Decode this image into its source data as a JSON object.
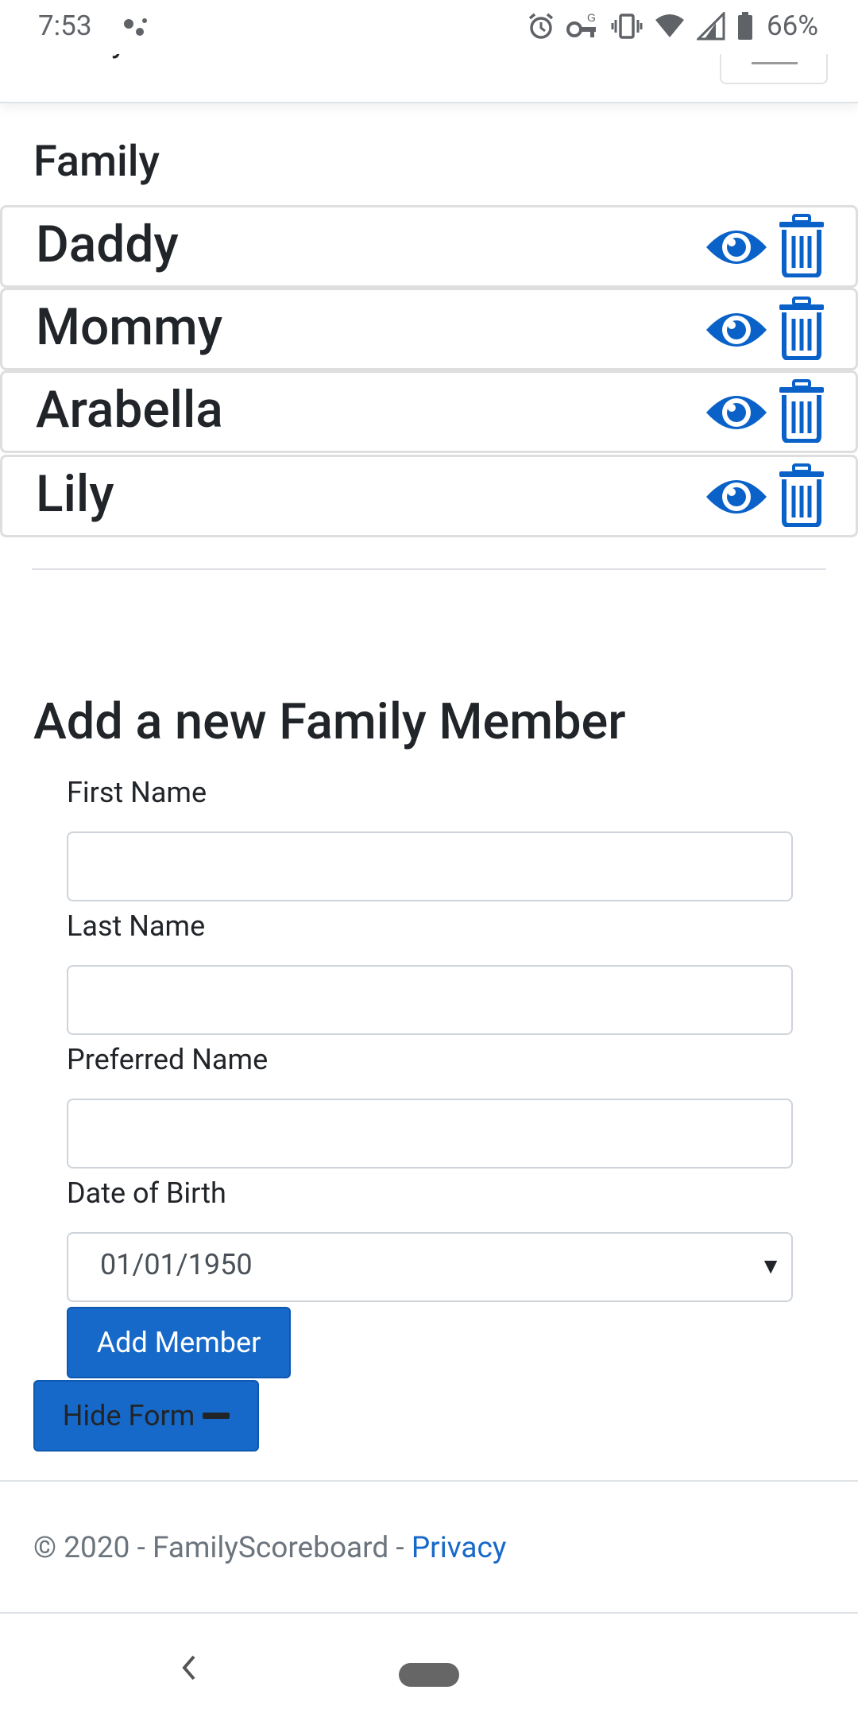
{
  "status": {
    "time": "7:53",
    "battery": "66%"
  },
  "navbar": {
    "brand": "FamilyScoreboard"
  },
  "family": {
    "heading": "Family",
    "members": [
      {
        "name": "Daddy"
      },
      {
        "name": "Mommy"
      },
      {
        "name": "Arabella"
      },
      {
        "name": "Lily"
      }
    ]
  },
  "form": {
    "heading": "Add a new Family Member",
    "first_name_label": "First Name",
    "first_name_value": "",
    "last_name_label": "Last Name",
    "last_name_value": "",
    "preferred_name_label": "Preferred Name",
    "preferred_name_value": "",
    "dob_label": "Date of Birth",
    "dob_value": "01/01/1950",
    "submit_label": "Add Member",
    "hide_label": "Hide Form"
  },
  "footer": {
    "text": "© 2020 - FamilyScoreboard - ",
    "privacy_link": "Privacy"
  },
  "colors": {
    "primary": "#1769c9",
    "icon": "#0a62c9"
  }
}
